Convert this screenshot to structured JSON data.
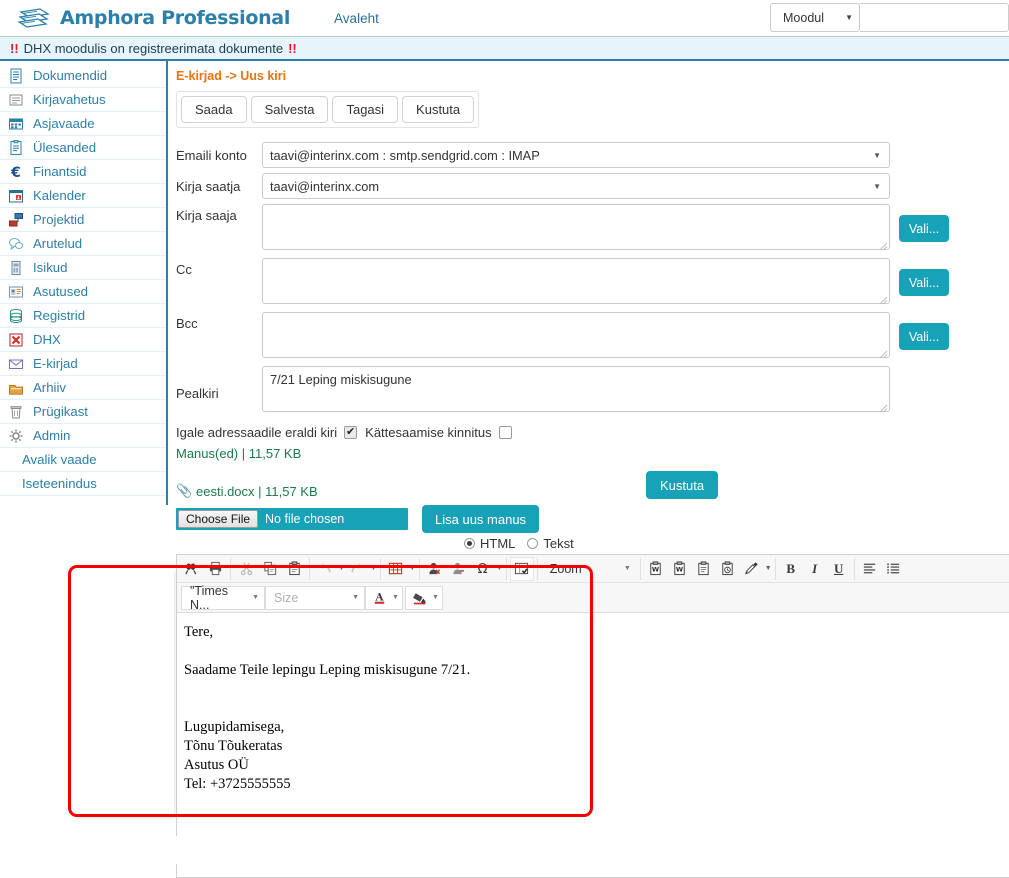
{
  "header": {
    "brand": "Amphora Professional",
    "brand_color": "#2b7fa8",
    "nav_link": "Avaleht",
    "module_select": "Moodul",
    "caret": "▼"
  },
  "notice": {
    "bang_left": "!!",
    "message": "DHX moodulis on registreerimata dokumente",
    "bang_right": "!!",
    "bang_color": "#e02020",
    "bg_color": "#e8f4fb"
  },
  "sidebar": {
    "items": [
      {
        "label": "Dokumendid",
        "icon": "document-icon"
      },
      {
        "label": "Kirjavahetus",
        "icon": "correspondence-icon"
      },
      {
        "label": "Asjavaade",
        "icon": "case-view-icon"
      },
      {
        "label": "Ülesanded",
        "icon": "tasks-icon"
      },
      {
        "label": "Finantsid",
        "icon": "euro-icon"
      },
      {
        "label": "Kalender",
        "icon": "calendar-icon"
      },
      {
        "label": "Projektid",
        "icon": "projects-icon"
      },
      {
        "label": "Arutelud",
        "icon": "discussion-icon"
      },
      {
        "label": "Isikud",
        "icon": "persons-icon"
      },
      {
        "label": "Asutused",
        "icon": "organizations-icon"
      },
      {
        "label": "Registrid",
        "icon": "database-icon"
      },
      {
        "label": "DHX",
        "icon": "dhx-icon"
      },
      {
        "label": "E-kirjad",
        "icon": "mail-icon"
      },
      {
        "label": "Arhiiv",
        "icon": "archive-icon"
      },
      {
        "label": "Prügikast",
        "icon": "trash-icon"
      },
      {
        "label": "Admin",
        "icon": "gear-icon"
      }
    ],
    "plain_items": [
      {
        "label": "Avalik vaade"
      },
      {
        "label": "Iseteenindus"
      }
    ],
    "accent": "#2b7fa8"
  },
  "content": {
    "breadcrumb": "E-kirjad -> Uus kiri",
    "breadcrumb_color": "#e8730f",
    "action_buttons": [
      {
        "label": "Saada"
      },
      {
        "label": "Salvesta"
      },
      {
        "label": "Tagasi"
      },
      {
        "label": "Kustuta"
      }
    ],
    "form": {
      "account_label": "Emaili konto",
      "account_value": "taavi@interinx.com : smtp.sendgrid.com : IMAP",
      "sender_label": "Kirja saatja",
      "sender_value": "taavi@interinx.com",
      "to_label": "Kirja saaja",
      "to_value": "",
      "cc_label": "Cc",
      "cc_value": "",
      "bcc_label": "Bcc",
      "bcc_value": "",
      "subject_label": "Pealkiri",
      "subject_value": "7/21 Leping miskisugune",
      "pick_button": "Vali...",
      "caret": "▼"
    },
    "options": {
      "separate_label": "Igale adressaadile eraldi kiri",
      "separate_checked": true,
      "receipt_label": "Kättesaamise kinnitus",
      "receipt_checked": false,
      "check_glyph": "✔"
    },
    "attachments": {
      "header": "Manus(ed) | 11,57 KB",
      "header_color": "#1a7a4a",
      "clip_icon": "paperclip-icon",
      "file_name": "eesti.docx | 11,57 KB",
      "delete_button": "Kustuta",
      "choose_file_button": "Choose File",
      "no_file_text": "No file chosen",
      "add_button": "Lisa uus manus"
    },
    "format": {
      "html_label": "HTML",
      "html_selected": true,
      "text_label": "Tekst",
      "text_selected": false
    },
    "editor": {
      "toolbar_row1": [
        {
          "name": "find-icon",
          "glyph": "find",
          "arrow": false,
          "framed": false
        },
        {
          "name": "print-icon",
          "glyph": "print",
          "arrow": false,
          "framed": false
        },
        {
          "name": "cut-icon",
          "glyph": "cut",
          "arrow": false,
          "framed": false
        },
        {
          "name": "copy-icon",
          "glyph": "copy",
          "arrow": false,
          "framed": false
        },
        {
          "name": "paste-icon",
          "glyph": "paste",
          "arrow": false,
          "framed": false
        },
        {
          "name": "undo-icon",
          "glyph": "undo",
          "arrow": true,
          "framed": false
        },
        {
          "name": "redo-icon",
          "glyph": "redo",
          "arrow": true,
          "framed": false
        },
        {
          "name": "table-icon",
          "glyph": "table",
          "arrow": true,
          "framed": false
        },
        {
          "name": "link-icon",
          "glyph": "link",
          "arrow": false,
          "framed": false
        },
        {
          "name": "unlink-icon",
          "glyph": "unlink",
          "arrow": false,
          "framed": false
        },
        {
          "name": "special-char-icon",
          "glyph": "omega",
          "arrow": true,
          "framed": false
        },
        {
          "name": "form-icon",
          "glyph": "form",
          "arrow": false,
          "framed": true
        }
      ],
      "zoom_label": "Zoom",
      "toolbar_row1b": [
        {
          "name": "paste-from-word-icon",
          "glyph": "pword1",
          "arrow": false
        },
        {
          "name": "paste-from-word2-icon",
          "glyph": "pword2",
          "arrow": false
        },
        {
          "name": "paste-text-icon",
          "glyph": "ptext",
          "arrow": false
        },
        {
          "name": "paste-clock-icon",
          "glyph": "pclock",
          "arrow": false
        },
        {
          "name": "format-brush-icon",
          "glyph": "brush",
          "arrow": true
        }
      ],
      "toolbar_row1c": [
        {
          "name": "bold-icon",
          "glyph": "B"
        },
        {
          "name": "italic-icon",
          "glyph": "I"
        },
        {
          "name": "underline-icon",
          "glyph": "U"
        },
        {
          "name": "align-left-icon",
          "glyph": "align"
        },
        {
          "name": "align-more-icon",
          "glyph": "align2"
        }
      ],
      "font_name": "\"Times N...",
      "size_placeholder": "Size",
      "text_color_icon": "text-color-icon",
      "bg_color_icon": "background-color-icon",
      "caret": "▾",
      "body_lines": [
        "Tere,",
        "",
        "Saadame Teile lepingu Leping miskisugune 7/21.",
        "",
        "",
        "Lugupidamisega,",
        "Tõnu Tõukeratas",
        "Asutus OÜ",
        "Tel: +3725555555"
      ]
    }
  },
  "annotation": {
    "name": "red-highlight-rectangle",
    "color": "#f40000"
  },
  "theme": {
    "teal": "#17a2b8",
    "blue": "#2b7fa8",
    "orange": "#e8730f",
    "green": "#1a7a4a"
  }
}
